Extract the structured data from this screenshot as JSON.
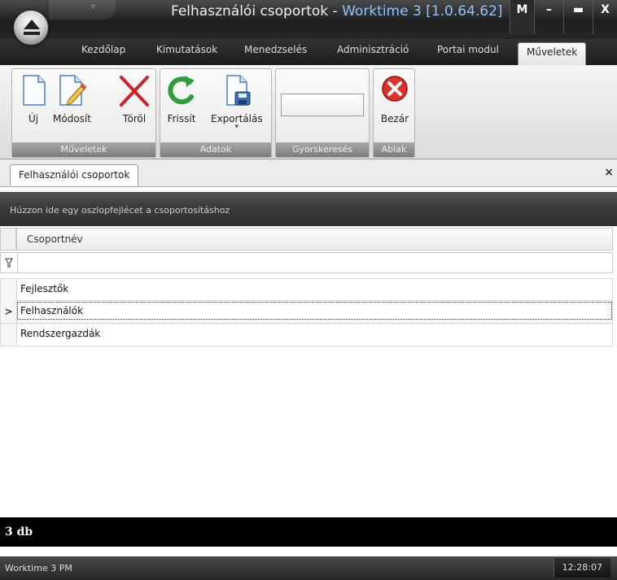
{
  "window": {
    "title": "Felhasználói csoportok",
    "title_sep": " - ",
    "app_name": "Worktime 3 [1.0.64.62]",
    "extra_btn": "M",
    "minimize": "–",
    "maximize": "▬",
    "close": "X"
  },
  "qat": {
    "arrow": "▿"
  },
  "tabs": [
    {
      "label": "Kezdőlap"
    },
    {
      "label": "Kimutatások"
    },
    {
      "label": "Menedzselés"
    },
    {
      "label": "Adminisztráció"
    },
    {
      "label": "Portai modul"
    },
    {
      "label": "Műveletek",
      "active": true
    }
  ],
  "ribbon": {
    "groups": [
      {
        "label": "Műveletek",
        "buttons": [
          "Új",
          "Módosít",
          "Töröl"
        ]
      },
      {
        "label": "Adatok",
        "buttons": [
          "Frissít",
          "Exportálás"
        ]
      },
      {
        "label": "Gyorskeresés"
      },
      {
        "label": "Ablak",
        "buttons": [
          "Bezár"
        ]
      }
    ],
    "export_dropdown": "▾"
  },
  "document": {
    "tab_label": "Felhasználói csoportok",
    "close": "×"
  },
  "grid": {
    "group_hint": "Húzzon ide egy oszlopfejlécet a csoportosításhoz",
    "columns": [
      "Csoportnév"
    ],
    "rows": [
      {
        "name": "Fejlesztők",
        "selected": false
      },
      {
        "name": "Felhasználók",
        "selected": true
      },
      {
        "name": "Rendszergazdák",
        "selected": false
      }
    ],
    "selected_indicator": ">",
    "footer": "3 db"
  },
  "status": {
    "left": "Worktime 3 PM",
    "clock": "12:28:07"
  }
}
